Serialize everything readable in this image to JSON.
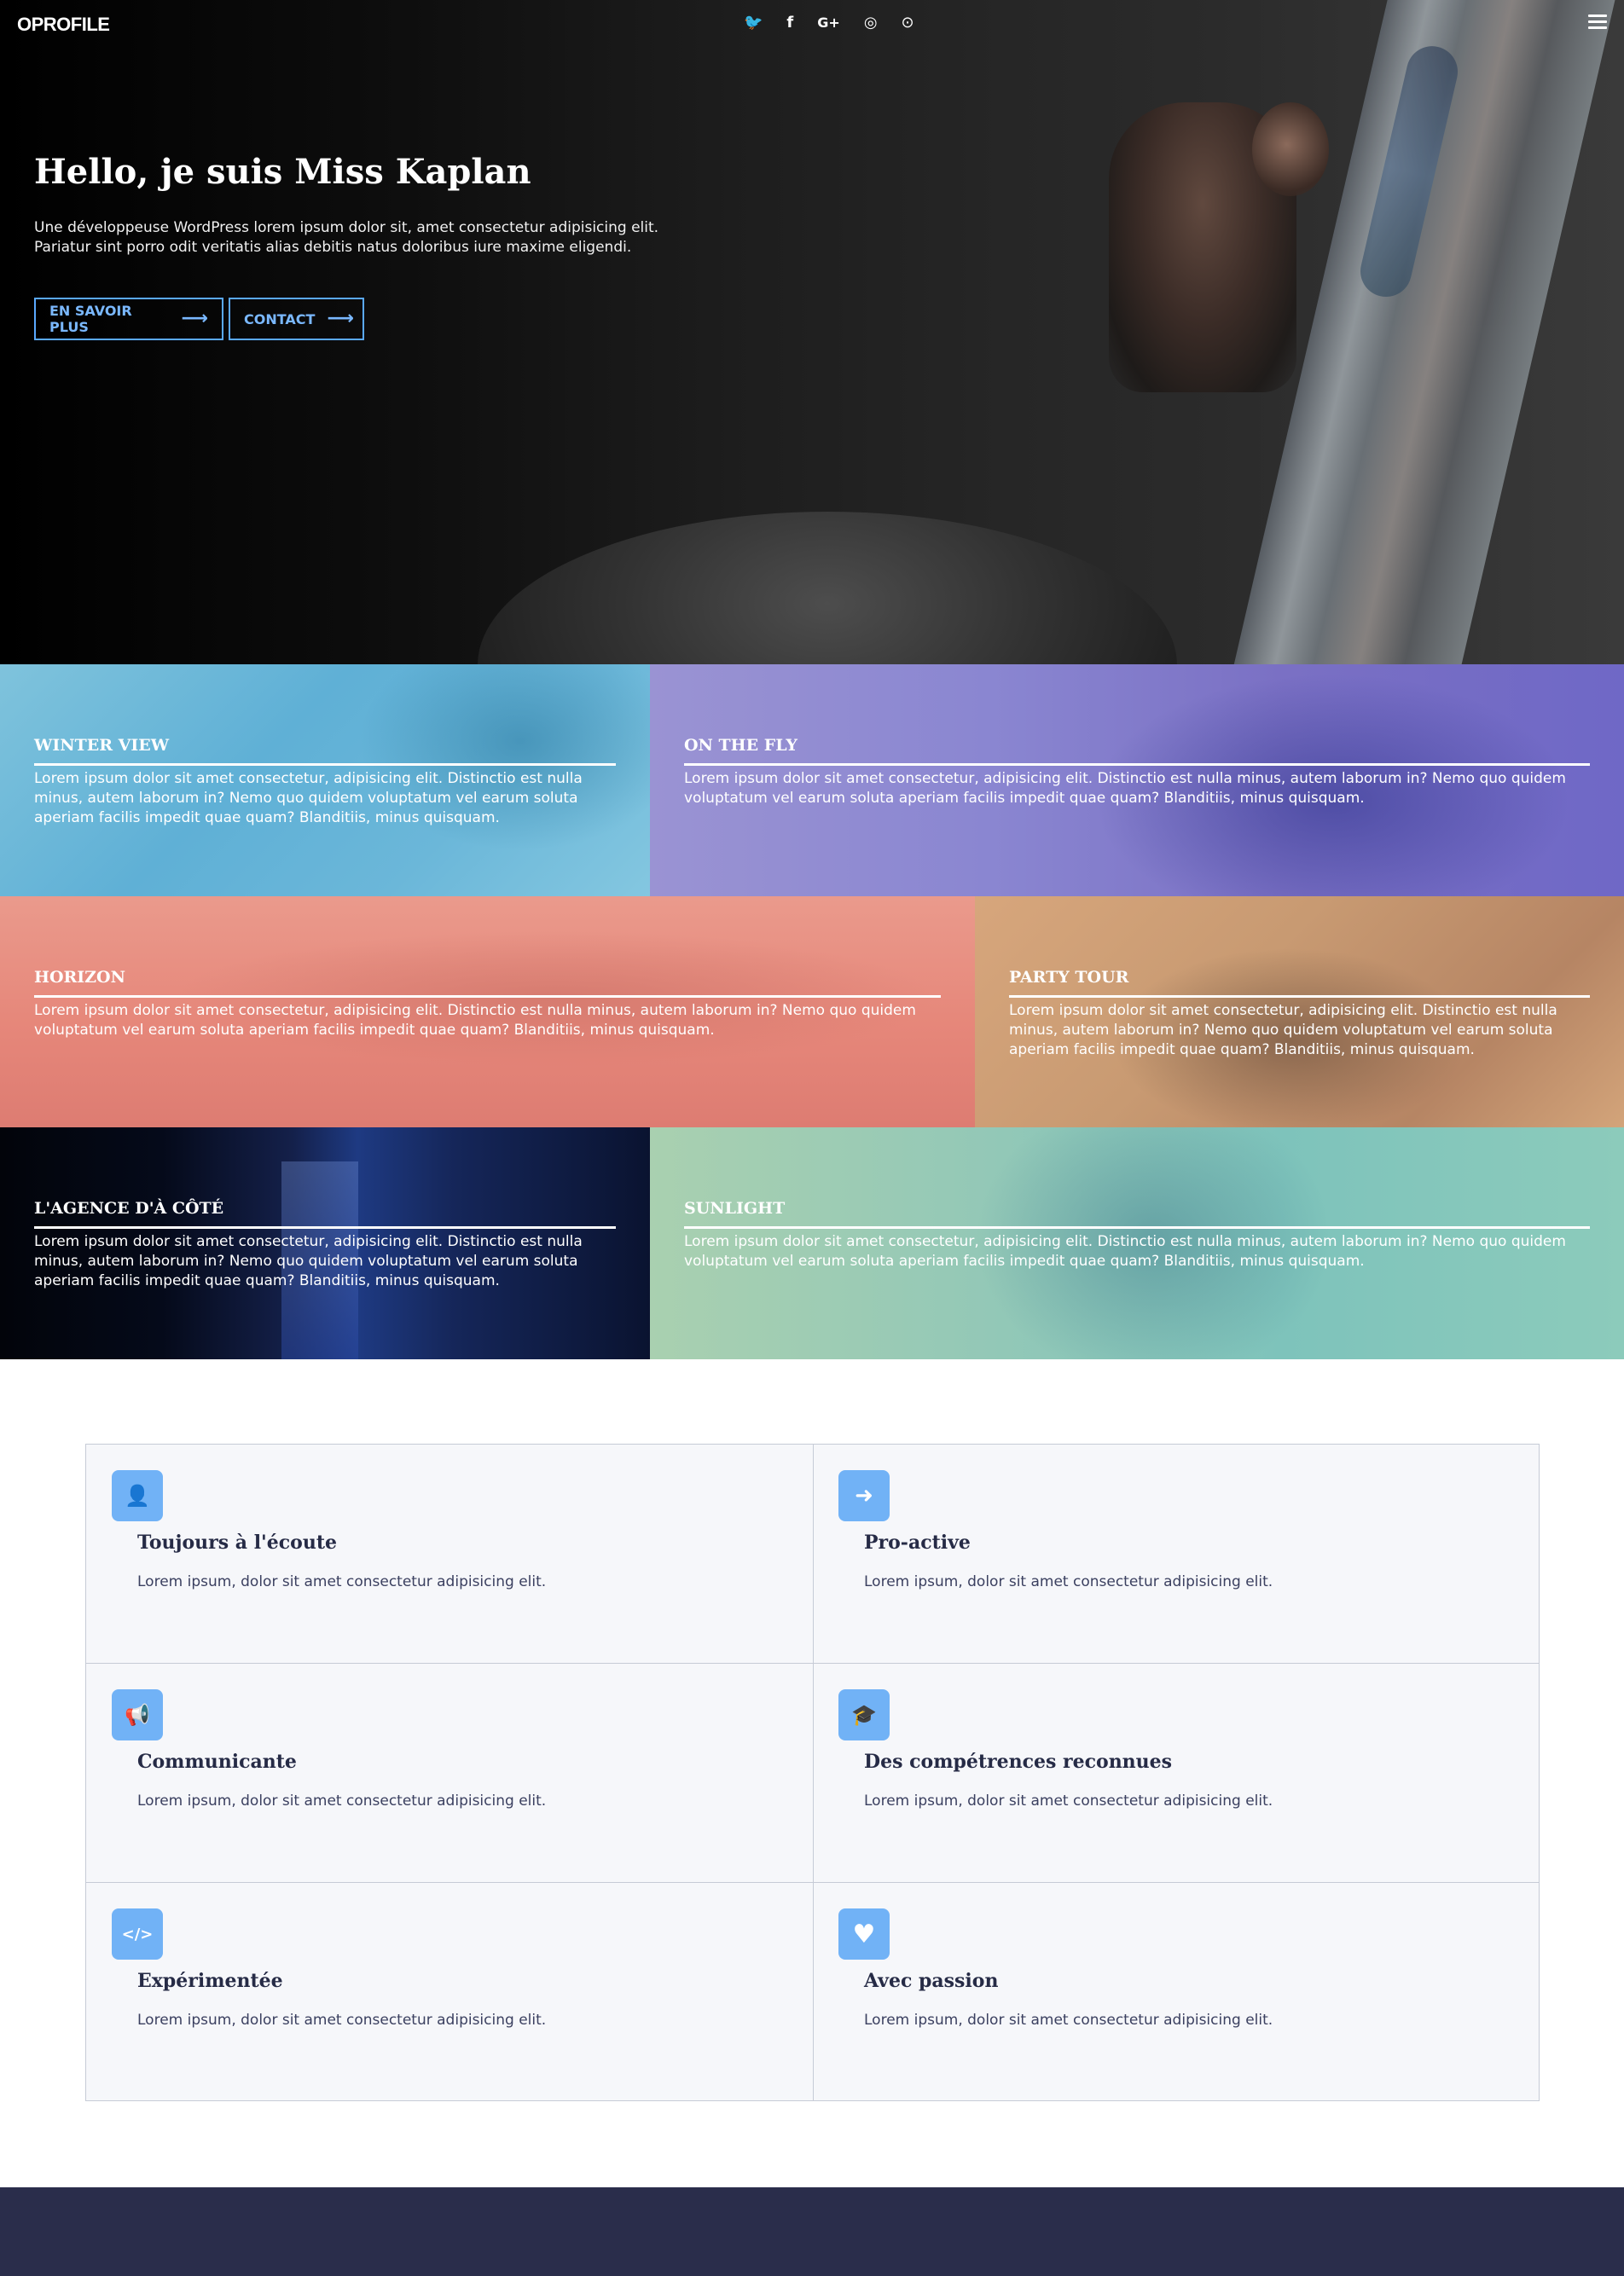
{
  "header": {
    "brand": "OPROFILE",
    "social_icons": [
      {
        "name": "twitter-icon",
        "glyph": "🐦"
      },
      {
        "name": "facebook-icon",
        "glyph": "f"
      },
      {
        "name": "google-plus-icon",
        "glyph": "G+"
      },
      {
        "name": "instagram-icon",
        "glyph": "◎"
      },
      {
        "name": "github-icon",
        "glyph": "⊙"
      }
    ],
    "menu_icon": "menu-icon"
  },
  "hero": {
    "title": "Hello, je suis Miss Kaplan",
    "text_line1": "Une développeuse WordPress lorem ipsum dolor sit, amet consectetur adipisicing elit.",
    "text_line2": "Pariatur sint porro odit veritatis alias debitis natus doloribus iure maxime eligendi.",
    "btn_more": "EN SAVOIR PLUS",
    "btn_contact": "CONTACT",
    "arrow": "⟶"
  },
  "tiles": [
    {
      "title": "WINTER VIEW",
      "text": "Lorem ipsum dolor sit amet consectetur, adipisicing elit. Distinctio est nulla minus, autem laborum in? Nemo quo quidem voluptatum vel earum soluta aperiam facilis impedit quae quam? Blanditiis, minus quisquam."
    },
    {
      "title": "ON THE FLY",
      "text": "Lorem ipsum dolor sit amet consectetur, adipisicing elit. Distinctio est nulla minus, autem laborum in? Nemo quo quidem voluptatum vel earum soluta aperiam facilis impedit quae quam? Blanditiis, minus quisquam."
    },
    {
      "title": "HORIZON",
      "text": "Lorem ipsum dolor sit amet consectetur, adipisicing elit. Distinctio est nulla minus, autem laborum in? Nemo quo quidem voluptatum vel earum soluta aperiam facilis impedit quae quam? Blanditiis, minus quisquam."
    },
    {
      "title": "PARTY TOUR",
      "text": "Lorem ipsum dolor sit amet consectetur, adipisicing elit. Distinctio est nulla minus, autem laborum in? Nemo quo quidem voluptatum vel earum soluta aperiam facilis impedit quae quam? Blanditiis, minus quisquam."
    },
    {
      "title": "L'AGENCE D'À CÔTÉ",
      "text": "Lorem ipsum dolor sit amet consectetur, adipisicing elit. Distinctio est nulla minus, autem laborum in? Nemo quo quidem voluptatum vel earum soluta aperiam facilis impedit quae quam? Blanditiis, minus quisquam."
    },
    {
      "title": "SUNLIGHT",
      "text": "Lorem ipsum dolor sit amet consectetur, adipisicing elit. Distinctio est nulla minus, autem laborum in? Nemo quo quidem voluptatum vel earum soluta aperiam facilis impedit quae quam? Blanditiis, minus quisquam."
    }
  ],
  "features": [
    {
      "title": "Toujours à l'écoute",
      "text": "Lorem ipsum, dolor sit amet consectetur adipisicing elit.",
      "icon": "user-icon",
      "glyph": "👤"
    },
    {
      "title": "Pro-active",
      "text": "Lorem ipsum, dolor sit amet consectetur adipisicing elit.",
      "icon": "arrow-right-icon",
      "glyph": "➜"
    },
    {
      "title": "Communicante",
      "text": "Lorem ipsum, dolor sit amet consectetur adipisicing elit.",
      "icon": "megaphone-icon",
      "glyph": "📢"
    },
    {
      "title": "Des compétrences reconnues",
      "text": "Lorem ipsum, dolor sit amet consectetur adipisicing elit.",
      "icon": "graduation-cap-icon",
      "glyph": "🎓"
    },
    {
      "title": "Expérimentée",
      "text": "Lorem ipsum, dolor sit amet consectetur adipisicing elit.",
      "icon": "code-icon",
      "glyph": "</>"
    },
    {
      "title": "Avec passion",
      "text": "Lorem ipsum, dolor sit amet consectetur adipisicing elit.",
      "icon": "heart-icon",
      "glyph": "♥"
    }
  ],
  "colors": {
    "accent": "#71b2f6",
    "button_border": "#5aa9ff",
    "footer": "#2a2d4b",
    "feature_bg": "#f6f7fa",
    "feature_text": "#262b46"
  }
}
